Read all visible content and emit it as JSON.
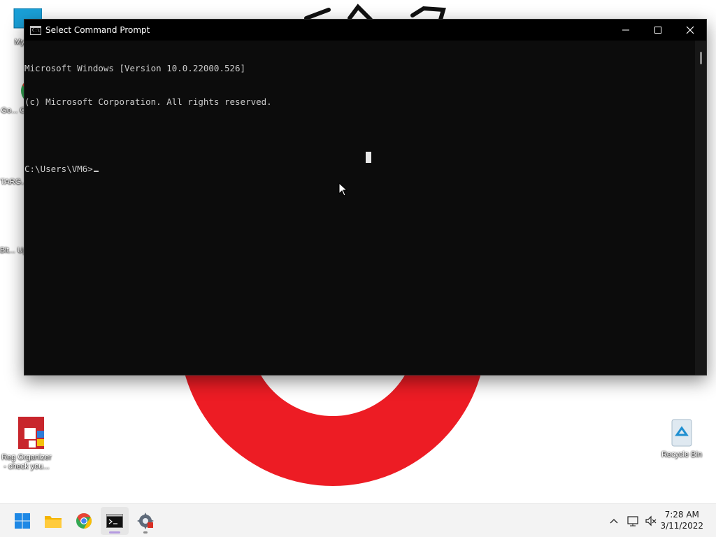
{
  "desktop": {
    "icons": [
      {
        "label": "My C..."
      },
      {
        "label": "Go... Chr..."
      },
      {
        "label": "TARG..."
      },
      {
        "label": "Bit... Up..."
      },
      {
        "label": "Reg Organizer - check you..."
      },
      {
        "label": "Recycle Bin"
      }
    ]
  },
  "cmd_window": {
    "title": "Select Command Prompt",
    "lines": [
      "Microsoft Windows [Version 10.0.22000.526]",
      "(c) Microsoft Corporation. All rights reserved.",
      "",
      "C:\\Users\\VM6>"
    ]
  },
  "taskbar": {
    "apps": [
      {
        "name": "Start",
        "icon": "windows-logo-icon"
      },
      {
        "name": "File Explorer",
        "icon": "folder-icon"
      },
      {
        "name": "Google Chrome",
        "icon": "chrome-icon"
      },
      {
        "name": "Command Prompt",
        "icon": "cmd-icon"
      },
      {
        "name": "Settings utility",
        "icon": "gear-icon"
      }
    ],
    "clock": {
      "time": "7:28 AM",
      "date": "3/11/2022"
    }
  },
  "colors": {
    "wallpaper_red": "#ed1c24",
    "console_bg": "#0c0c0c",
    "console_text": "#cccccc"
  }
}
